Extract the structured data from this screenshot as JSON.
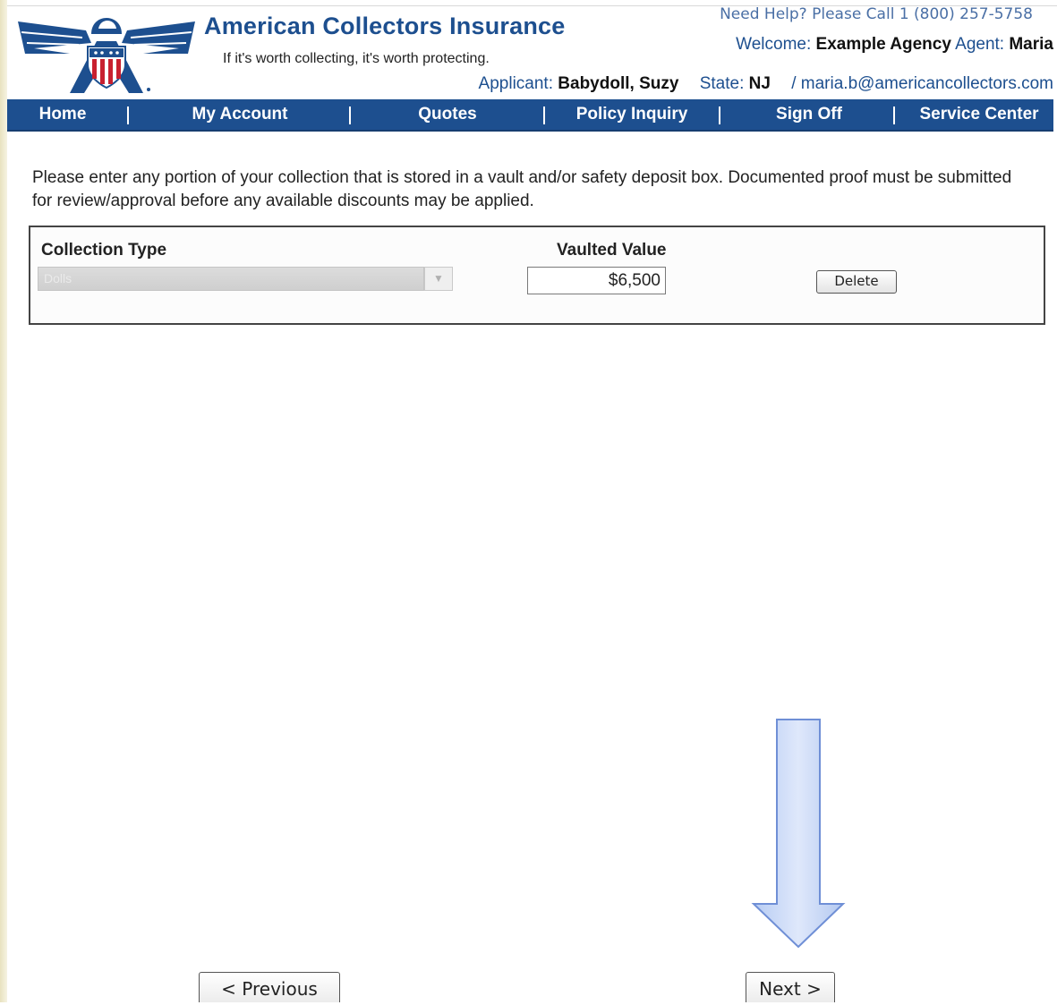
{
  "header": {
    "brand_title": "American Collectors Insurance",
    "tagline": "If it's worth collecting, it's worth protecting.",
    "help_text": "Need Help? Please Call 1 (800) 257-5758",
    "welcome_label": "Welcome:",
    "agency_name": "Example Agency",
    "agent_label": "Agent:",
    "agent_name": "Maria",
    "applicant_label": "Applicant:",
    "applicant_name": "Babydoll, Suzy",
    "state_label": "State:",
    "state_value": "NJ",
    "email_separator": "/",
    "email": "maria.b@americancollectors.com"
  },
  "nav": {
    "items": [
      {
        "label": "Home"
      },
      {
        "label": "My Account"
      },
      {
        "label": "Quotes"
      },
      {
        "label": "Policy Inquiry"
      },
      {
        "label": "Sign Off"
      },
      {
        "label": "Service Center"
      }
    ]
  },
  "main": {
    "instructions": "Please enter any portion of your collection that is stored in a vault and/or safety deposit box. Documented proof must be submitted for review/approval before any available discounts may be applied.",
    "table": {
      "col_collection_type": "Collection Type",
      "col_vaulted_value": "Vaulted Value",
      "row": {
        "collection_type": "Dolls",
        "vaulted_value": "$6,500",
        "delete_label": "Delete"
      }
    }
  },
  "footer": {
    "previous_label": "< Previous",
    "next_label": "Next >"
  },
  "colors": {
    "brand_blue": "#1d4f8f",
    "arrow_fill": "#c9d9f7",
    "arrow_stroke": "#6f8fd6"
  }
}
